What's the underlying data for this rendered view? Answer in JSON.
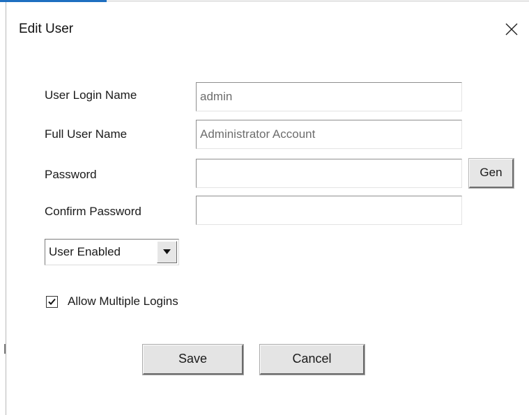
{
  "dialog": {
    "title": "Edit User",
    "close_icon": "close-icon"
  },
  "form": {
    "login_name": {
      "label": "User Login Name",
      "value": "admin"
    },
    "full_name": {
      "label": "Full User Name",
      "value": "Administrator Account"
    },
    "password": {
      "label": "Password",
      "value": "",
      "gen_label": "Gen"
    },
    "confirm_password": {
      "label": "Confirm Password",
      "value": ""
    },
    "status": {
      "selected": "User Enabled",
      "arrow_icon": "chevron-down-icon"
    },
    "multiple_logins": {
      "label": "Allow Multiple Logins",
      "checked": true,
      "check_icon": "checkmark-icon"
    }
  },
  "buttons": {
    "save_label": "Save",
    "cancel_label": "Cancel"
  },
  "colors": {
    "accent": "#1f6fc0",
    "field_text": "#6d6d6d",
    "button_face": "#e4e4e4"
  }
}
